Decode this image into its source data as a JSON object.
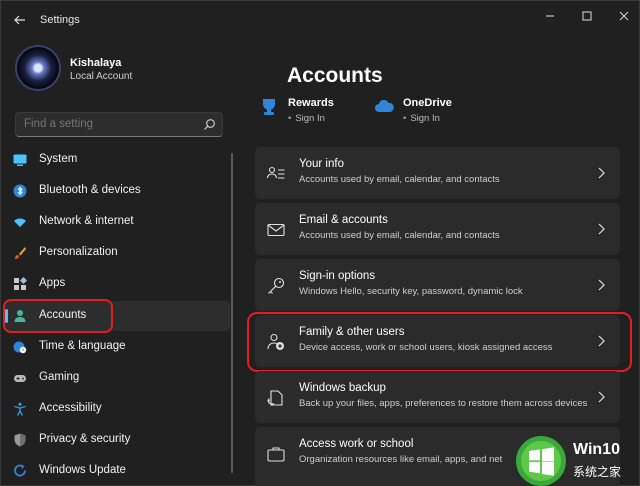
{
  "window": {
    "title": "Settings"
  },
  "profile": {
    "name": "Kishalaya",
    "account_type": "Local Account"
  },
  "search": {
    "placeholder": "Find a setting"
  },
  "sidebar": {
    "items": [
      {
        "label": "System",
        "icon": "monitor-icon"
      },
      {
        "label": "Bluetooth & devices",
        "icon": "bluetooth-icon"
      },
      {
        "label": "Network & internet",
        "icon": "wifi-icon"
      },
      {
        "label": "Personalization",
        "icon": "paintbrush-icon"
      },
      {
        "label": "Apps",
        "icon": "apps-grid-icon"
      },
      {
        "label": "Accounts",
        "icon": "person-icon",
        "selected": true
      },
      {
        "label": "Time & language",
        "icon": "globe-clock-icon"
      },
      {
        "label": "Gaming",
        "icon": "gamepad-icon"
      },
      {
        "label": "Accessibility",
        "icon": "accessibility-icon"
      },
      {
        "label": "Privacy & security",
        "icon": "shield-icon"
      },
      {
        "label": "Windows Update",
        "icon": "update-icon"
      }
    ]
  },
  "main": {
    "title": "Accounts",
    "services": [
      {
        "name": "Rewards",
        "status": "Sign In",
        "icon": "trophy-icon"
      },
      {
        "name": "OneDrive",
        "status": "Sign In",
        "icon": "cloud-icon"
      }
    ],
    "cards": [
      {
        "title": "Your info",
        "subtitle": "Accounts used by email, calendar, and contacts",
        "icon": "person-card-icon"
      },
      {
        "title": "Email & accounts",
        "subtitle": "Accounts used by email, calendar, and contacts",
        "icon": "mail-icon"
      },
      {
        "title": "Sign-in options",
        "subtitle": "Windows Hello, security key, password, dynamic lock",
        "icon": "key-icon"
      },
      {
        "title": "Family & other users",
        "subtitle": "Device access, work or school users, kiosk assigned access",
        "icon": "family-icon"
      },
      {
        "title": "Windows backup",
        "subtitle": "Back up your files, apps, preferences to restore them across devices",
        "icon": "backup-icon"
      },
      {
        "title": "Access work or school",
        "subtitle": "Organization resources like email, apps, and net",
        "icon": "briefcase-icon"
      }
    ]
  },
  "watermark": {
    "line1": "Win10",
    "line2": "系统之家"
  },
  "colors": {
    "background": "#202020",
    "card": "#2b2b2b",
    "accent": "#4cc2ff",
    "highlight": "#e02020"
  }
}
